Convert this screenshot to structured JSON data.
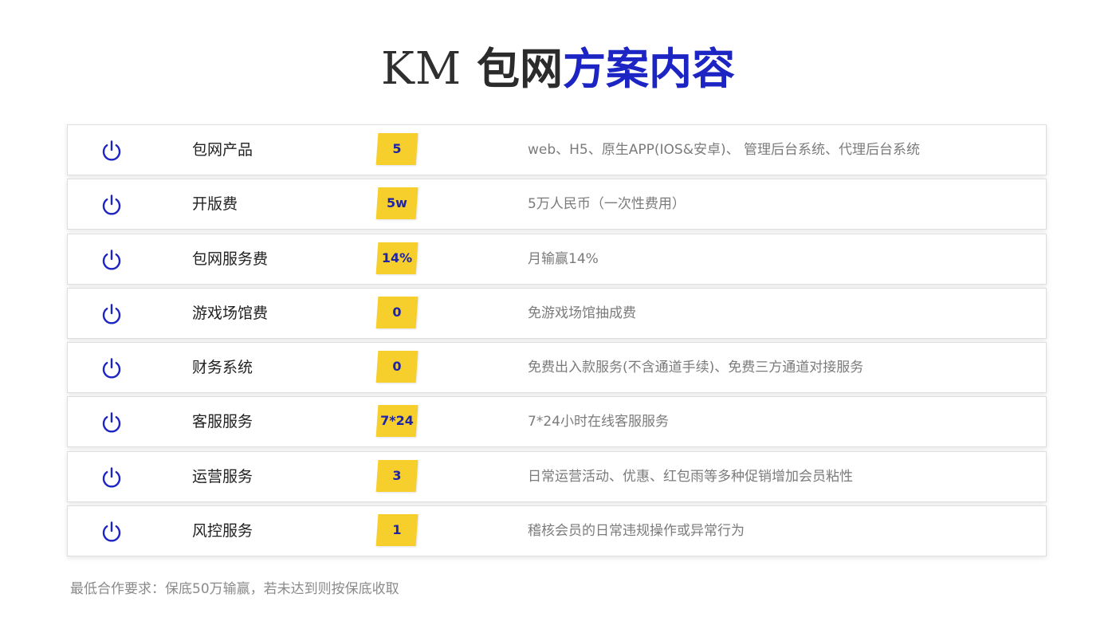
{
  "title": {
    "brand": "KM",
    "part_dark": "包网",
    "part_blue": "方案内容"
  },
  "colors": {
    "accent_blue": "#1d24c4",
    "badge_yellow": "#f7cf2d"
  },
  "rows": [
    {
      "icon": "power-icon",
      "label": "包网产品",
      "badge": "5",
      "description": "web、H5、原生APP(IOS&安卓)、 管理后台系统、代理后台系统"
    },
    {
      "icon": "power-icon",
      "label": "开版费",
      "badge": "5w",
      "description": "5万人民币（一次性费用）"
    },
    {
      "icon": "power-icon",
      "label": "包网服务费",
      "badge": "14%",
      "description": "月输赢14%"
    },
    {
      "icon": "power-icon",
      "label": "游戏场馆费",
      "badge": "0",
      "description": "免游戏场馆抽成费"
    },
    {
      "icon": "power-icon",
      "label": "财务系统",
      "badge": "0",
      "description": "免费出入款服务(不含通道手续)、免费三方通道对接服务"
    },
    {
      "icon": "power-icon",
      "label": "客服服务",
      "badge": "7*24",
      "description": "7*24小时在线客服服务"
    },
    {
      "icon": "power-icon",
      "label": "运营服务",
      "badge": "3",
      "description": "日常运营活动、优惠、红包雨等多种促销增加会员粘性"
    },
    {
      "icon": "power-icon",
      "label": "风控服务",
      "badge": "1",
      "description": "稽核会员的日常违规操作或异常行为"
    }
  ],
  "footnote": "最低合作要求：保底50万输赢，若未达到则按保底收取"
}
